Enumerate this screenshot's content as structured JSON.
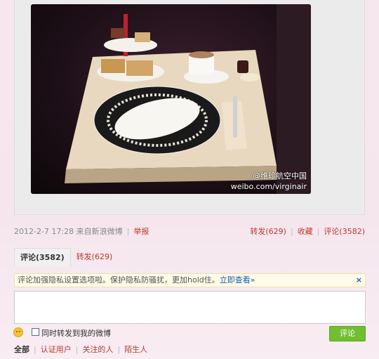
{
  "photo": {
    "watermark_line1": "@维珍航空中国",
    "watermark_line2": "weibo.com/virginair"
  },
  "meta": {
    "date": "2012-2-7 17:28",
    "source": "来自新浪微博",
    "report": "举报",
    "forward": "转发(629)",
    "favorite": "收藏",
    "comment": "评论(3582)"
  },
  "tabs": [
    {
      "label": "评论(3582)",
      "active": true
    },
    {
      "label": "转发(629)",
      "active": false
    }
  ],
  "notice": {
    "text": "评论加强隐私设置选项啦。保护隐私防骚扰，更加hold住。",
    "link": "立即查看»",
    "close": "×"
  },
  "composer": {
    "placeholder": "",
    "also_forward_label": "同时转发到我的微博",
    "submit_label": "评论"
  },
  "filters": [
    {
      "label": "全部",
      "active": true
    },
    {
      "label": "认证用户",
      "active": false
    },
    {
      "label": "关注的人",
      "active": false
    },
    {
      "label": "陌生人",
      "active": false
    }
  ]
}
